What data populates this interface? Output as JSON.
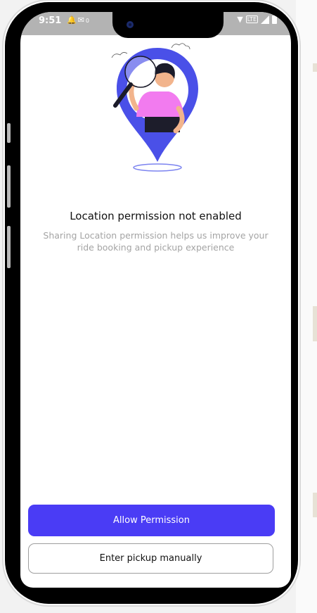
{
  "status_bar": {
    "time": "9:51",
    "notification_icons": [
      "bell-icon",
      "mail-icon"
    ],
    "data_speed": "0",
    "network_label": "LTE"
  },
  "permission_screen": {
    "title": "Location permission not enabled",
    "description": "Sharing Location permission helps us improve your ride booking and pickup experience",
    "allow_button_label": "Allow Permission",
    "manual_button_label": "Enter pickup manually"
  },
  "colors": {
    "primary": "#4a3cf5",
    "pin_blue": "#4a50e8",
    "shirt_pink": "#f27bef",
    "status_bar_bg": "#b3b3b3"
  }
}
